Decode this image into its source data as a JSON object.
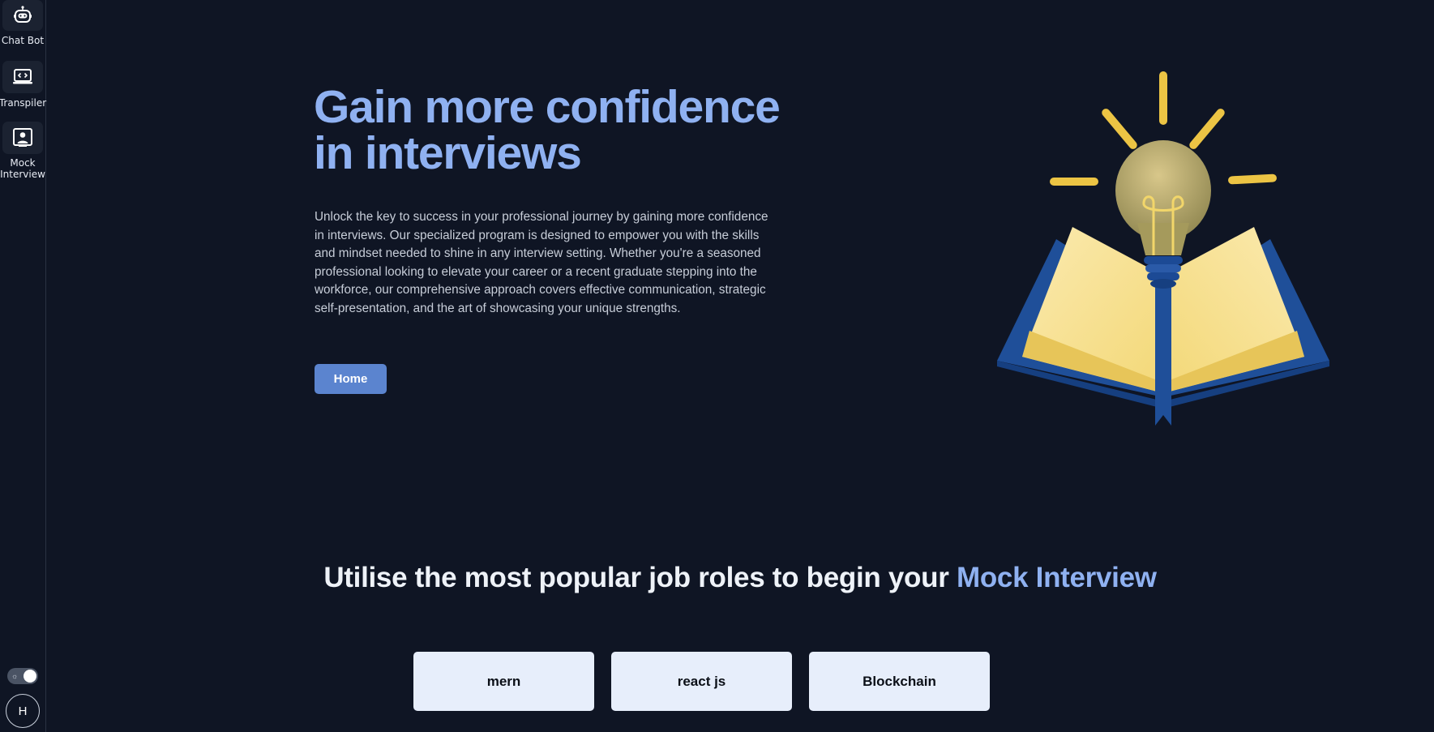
{
  "sidebar": {
    "items": [
      {
        "label": "Chat Bot",
        "icon": "robot-icon"
      },
      {
        "label": "Transpiler",
        "icon": "code-monitor-icon"
      },
      {
        "label": "Mock Interview",
        "icon": "user-presentation-icon"
      }
    ],
    "theme_toggle": {
      "state": "dark",
      "icon": "sun-icon"
    },
    "avatar_initial": "H"
  },
  "hero": {
    "title": "Gain more confidence in interviews",
    "description": "Unlock the key to success in your professional journey by gaining more confidence in interviews. Our specialized program is designed to empower you with the skills and mindset needed to shine in any interview setting. Whether you're a seasoned professional looking to elevate your career or a recent graduate stepping into the workforce, our comprehensive approach covers effective communication, strategic self-presentation, and the art of showcasing your unique strengths.",
    "button_label": "Home",
    "illustration": "lightbulb-book-illustration"
  },
  "roles_section": {
    "title_prefix": "Utilise the most popular job roles to begin your ",
    "title_highlight": "Mock Interview",
    "roles": [
      "mern",
      "react js",
      "Blockchain"
    ]
  },
  "colors": {
    "background": "#0f1524",
    "accent": "#8fb1f1",
    "button": "#5b84cf",
    "card": "#e7eefb"
  }
}
